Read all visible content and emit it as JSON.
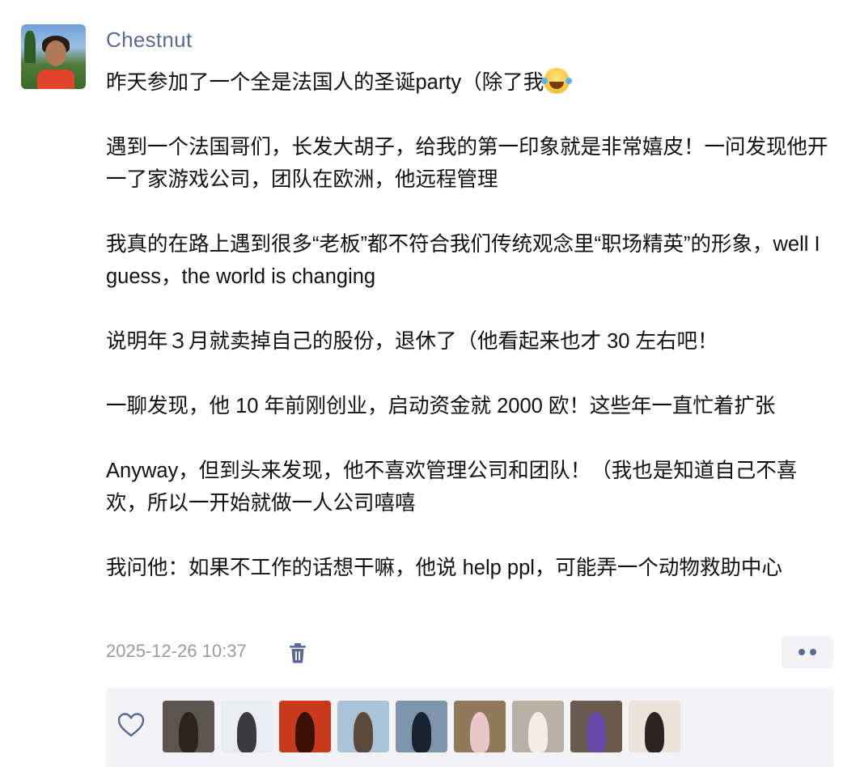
{
  "post": {
    "author": "Chestnut",
    "paragraphs": [
      "昨天参加了一个全是法国人的圣诞party（除了我",
      "遇到一个法国哥们，长发大胡子，给我的第一印象就是非常嬉皮！一问发现他开一了家游戏公司，团队在欧洲，他远程管理",
      "我真的在路上遇到很多“老板”都不符合我们传统观念里“职场精英”的形象，well I guess，the world is changing",
      "说明年３月就卖掉自己的股份，退休了（他看起来也才 30 左右吧！",
      "一聊发现，他 10 年前刚创业，启动资金就 2000 欧！这些年一直忙着扩张",
      "Anyway，但到头来发现，他不喜欢管理公司和团队！（我也是知道自己不喜欢，所以一开始就做一人公司嘻嘻",
      "我问他：如果不工作的话想干嘛，他说 help ppl，可能弄一个动物救助中心"
    ],
    "first_paragraph_emoji": "laughing-with-tears-emoji",
    "timestamp": "2025-12-26 10:37"
  },
  "icons": {
    "delete": "trash-icon",
    "more": "more-dots-icon",
    "like": "heart-icon"
  },
  "colors": {
    "author_name": "#576b95",
    "timestamp": "#9b9b9b",
    "panel_bg": "#f3f3f5",
    "accent": "#576b95"
  },
  "likes": {
    "avatars": [
      {
        "name": "liker-avatar-1",
        "bg": "#5a5550",
        "fg": "#2b2420"
      },
      {
        "name": "liker-avatar-2",
        "bg": "#e9edf2",
        "fg": "#3b3a3e"
      },
      {
        "name": "liker-avatar-3",
        "bg": "#c9391c",
        "fg": "#3a1008"
      },
      {
        "name": "liker-avatar-4",
        "bg": "#a9c3d8",
        "fg": "#5b4a3c"
      },
      {
        "name": "liker-avatar-5",
        "bg": "#7e94ad",
        "fg": "#1b2230"
      },
      {
        "name": "liker-avatar-6",
        "bg": "#8f7a5c",
        "fg": "#e8c7c9"
      },
      {
        "name": "liker-avatar-7",
        "bg": "#b7b0a4",
        "fg": "#f1ece6"
      },
      {
        "name": "liker-avatar-8",
        "bg": "#6a5b4e",
        "fg": "#6a4aa8"
      },
      {
        "name": "liker-avatar-9",
        "bg": "#e9e3da",
        "fg": "#2a2524"
      }
    ]
  }
}
